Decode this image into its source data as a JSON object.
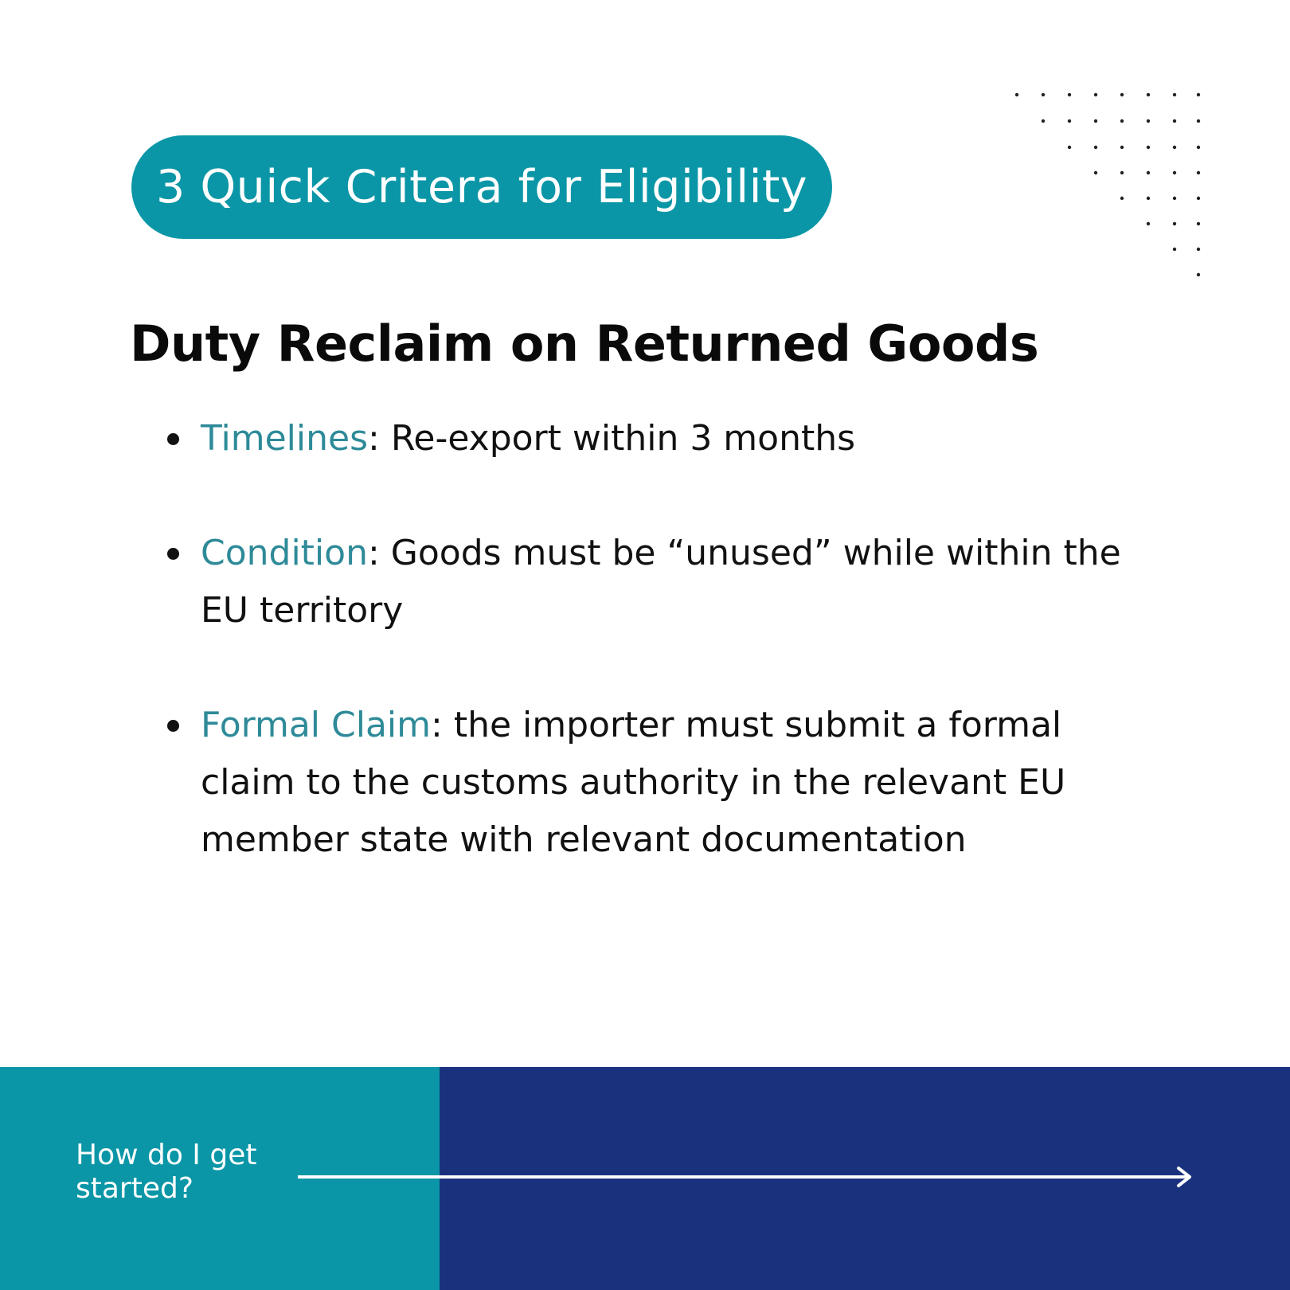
{
  "header": {
    "badge_text": "3 Quick Critera for Eligibility"
  },
  "main": {
    "title": "Duty Reclaim on Returned Goods",
    "criteria": [
      {
        "key": "Timelines",
        "text": ": Re-export within 3 months"
      },
      {
        "key": "Condition",
        "text": ": Goods must be “unused” while within the EU territory"
      },
      {
        "key": "Formal Claim",
        "text": ": the importer must submit a formal claim to the customs authority in the relevant EU member state with relevant documentation"
      }
    ]
  },
  "footer": {
    "cta_text": "How do I get started?"
  },
  "colors": {
    "teal": "#0a96a6",
    "navy": "#1a317d",
    "key_text": "#2e8a98"
  },
  "icons": {
    "decor": "dot-grid-icon",
    "cta": "arrow-right-icon"
  }
}
